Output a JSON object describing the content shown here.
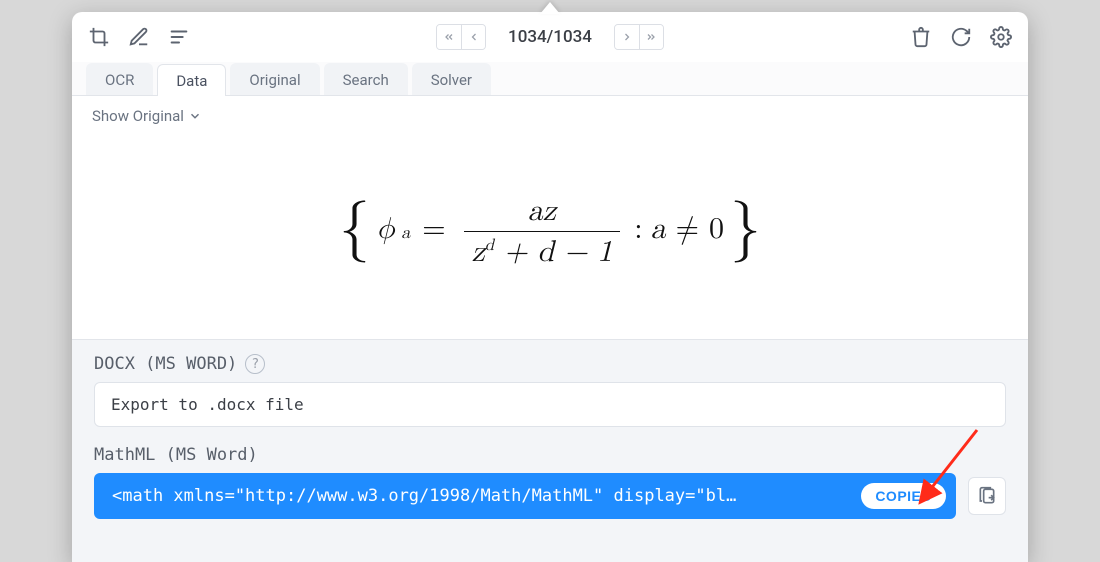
{
  "pager": {
    "counter": "1034/1034"
  },
  "tabs": {
    "items": [
      {
        "label": "OCR"
      },
      {
        "label": "Data"
      },
      {
        "label": "Original"
      },
      {
        "label": "Search"
      },
      {
        "label": "Solver"
      }
    ],
    "active_index": 1
  },
  "subheader": {
    "show_original_label": "Show Original"
  },
  "equation": {
    "phi": "ϕ",
    "sub_a": "a",
    "eq": "=",
    "num": "az",
    "den_z": "z",
    "den_sup": "d",
    "den_rest": " + d − 1",
    "colon": ":",
    "cond_a": "a",
    "neq": "≠",
    "zero": "0"
  },
  "export": {
    "docx_label": "DOCX (MS WORD)",
    "docx_button": "Export to .docx file",
    "mathml_label": "MathML (MS Word)",
    "mathml_value": "<math xmlns=\"http://www.w3.org/1998/Math/MathML\" display=\"bl…",
    "copied_pill": "COPIED"
  }
}
